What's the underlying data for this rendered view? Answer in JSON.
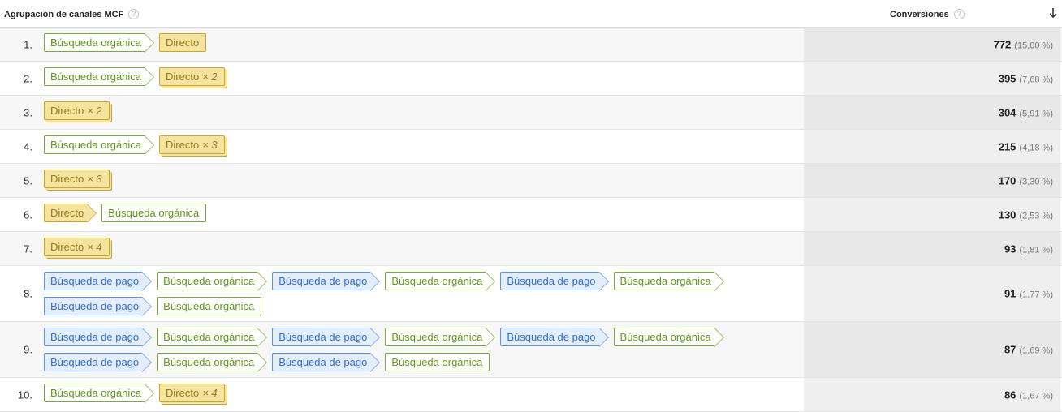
{
  "header": {
    "dimension_label": "Agrupación de canales MCF",
    "metric_label": "Conversiones",
    "help_glyph": "?"
  },
  "colors": {
    "organic": "#5f9a1c",
    "paid": "#2e6ed8",
    "direct": "#f5e3a0"
  },
  "rows": [
    {
      "index": "1.",
      "value": "772",
      "percent": "(15,00 %)",
      "path": [
        {
          "label": "Búsqueda orgánica",
          "type": "green",
          "mult": ""
        },
        {
          "label": "Directo",
          "type": "yellow",
          "mult": ""
        }
      ]
    },
    {
      "index": "2.",
      "value": "395",
      "percent": "(7,68 %)",
      "path": [
        {
          "label": "Búsqueda orgánica",
          "type": "green",
          "mult": ""
        },
        {
          "label": "Directo",
          "type": "yellow",
          "mult": "× 2"
        }
      ]
    },
    {
      "index": "3.",
      "value": "304",
      "percent": "(5,91 %)",
      "path": [
        {
          "label": "Directo",
          "type": "yellow",
          "mult": "× 2"
        }
      ]
    },
    {
      "index": "4.",
      "value": "215",
      "percent": "(4,18 %)",
      "path": [
        {
          "label": "Búsqueda orgánica",
          "type": "green",
          "mult": ""
        },
        {
          "label": "Directo",
          "type": "yellow",
          "mult": "× 3"
        }
      ]
    },
    {
      "index": "5.",
      "value": "170",
      "percent": "(3,30 %)",
      "path": [
        {
          "label": "Directo",
          "type": "yellow",
          "mult": "× 3"
        }
      ]
    },
    {
      "index": "6.",
      "value": "130",
      "percent": "(2,53 %)",
      "path": [
        {
          "label": "Directo",
          "type": "yellow",
          "mult": ""
        },
        {
          "label": "Búsqueda orgánica",
          "type": "green",
          "mult": ""
        }
      ]
    },
    {
      "index": "7.",
      "value": "93",
      "percent": "(1,81 %)",
      "path": [
        {
          "label": "Directo",
          "type": "yellow",
          "mult": "× 4"
        }
      ]
    },
    {
      "index": "8.",
      "value": "91",
      "percent": "(1,77 %)",
      "path": [
        {
          "label": "Búsqueda de pago",
          "type": "blue",
          "mult": ""
        },
        {
          "label": "Búsqueda orgánica",
          "type": "green",
          "mult": ""
        },
        {
          "label": "Búsqueda de pago",
          "type": "blue",
          "mult": ""
        },
        {
          "label": "Búsqueda orgánica",
          "type": "green",
          "mult": ""
        },
        {
          "label": "Búsqueda de pago",
          "type": "blue",
          "mult": ""
        },
        {
          "label": "Búsqueda orgánica",
          "type": "green",
          "mult": ""
        },
        {
          "label": "Búsqueda de pago",
          "type": "blue",
          "mult": ""
        },
        {
          "label": "Búsqueda orgánica",
          "type": "green",
          "mult": ""
        }
      ]
    },
    {
      "index": "9.",
      "value": "87",
      "percent": "(1,69 %)",
      "path": [
        {
          "label": "Búsqueda de pago",
          "type": "blue",
          "mult": ""
        },
        {
          "label": "Búsqueda orgánica",
          "type": "green",
          "mult": ""
        },
        {
          "label": "Búsqueda de pago",
          "type": "blue",
          "mult": ""
        },
        {
          "label": "Búsqueda orgánica",
          "type": "green",
          "mult": ""
        },
        {
          "label": "Búsqueda de pago",
          "type": "blue",
          "mult": ""
        },
        {
          "label": "Búsqueda orgánica",
          "type": "green",
          "mult": ""
        },
        {
          "label": "Búsqueda de pago",
          "type": "blue",
          "mult": ""
        },
        {
          "label": "Búsqueda orgánica",
          "type": "green",
          "mult": ""
        },
        {
          "label": "Búsqueda de pago",
          "type": "blue",
          "mult": ""
        },
        {
          "label": "Búsqueda orgánica",
          "type": "green",
          "mult": ""
        }
      ]
    },
    {
      "index": "10.",
      "value": "86",
      "percent": "(1,67 %)",
      "path": [
        {
          "label": "Búsqueda orgánica",
          "type": "green",
          "mult": ""
        },
        {
          "label": "Directo",
          "type": "yellow",
          "mult": "× 4"
        }
      ]
    }
  ]
}
